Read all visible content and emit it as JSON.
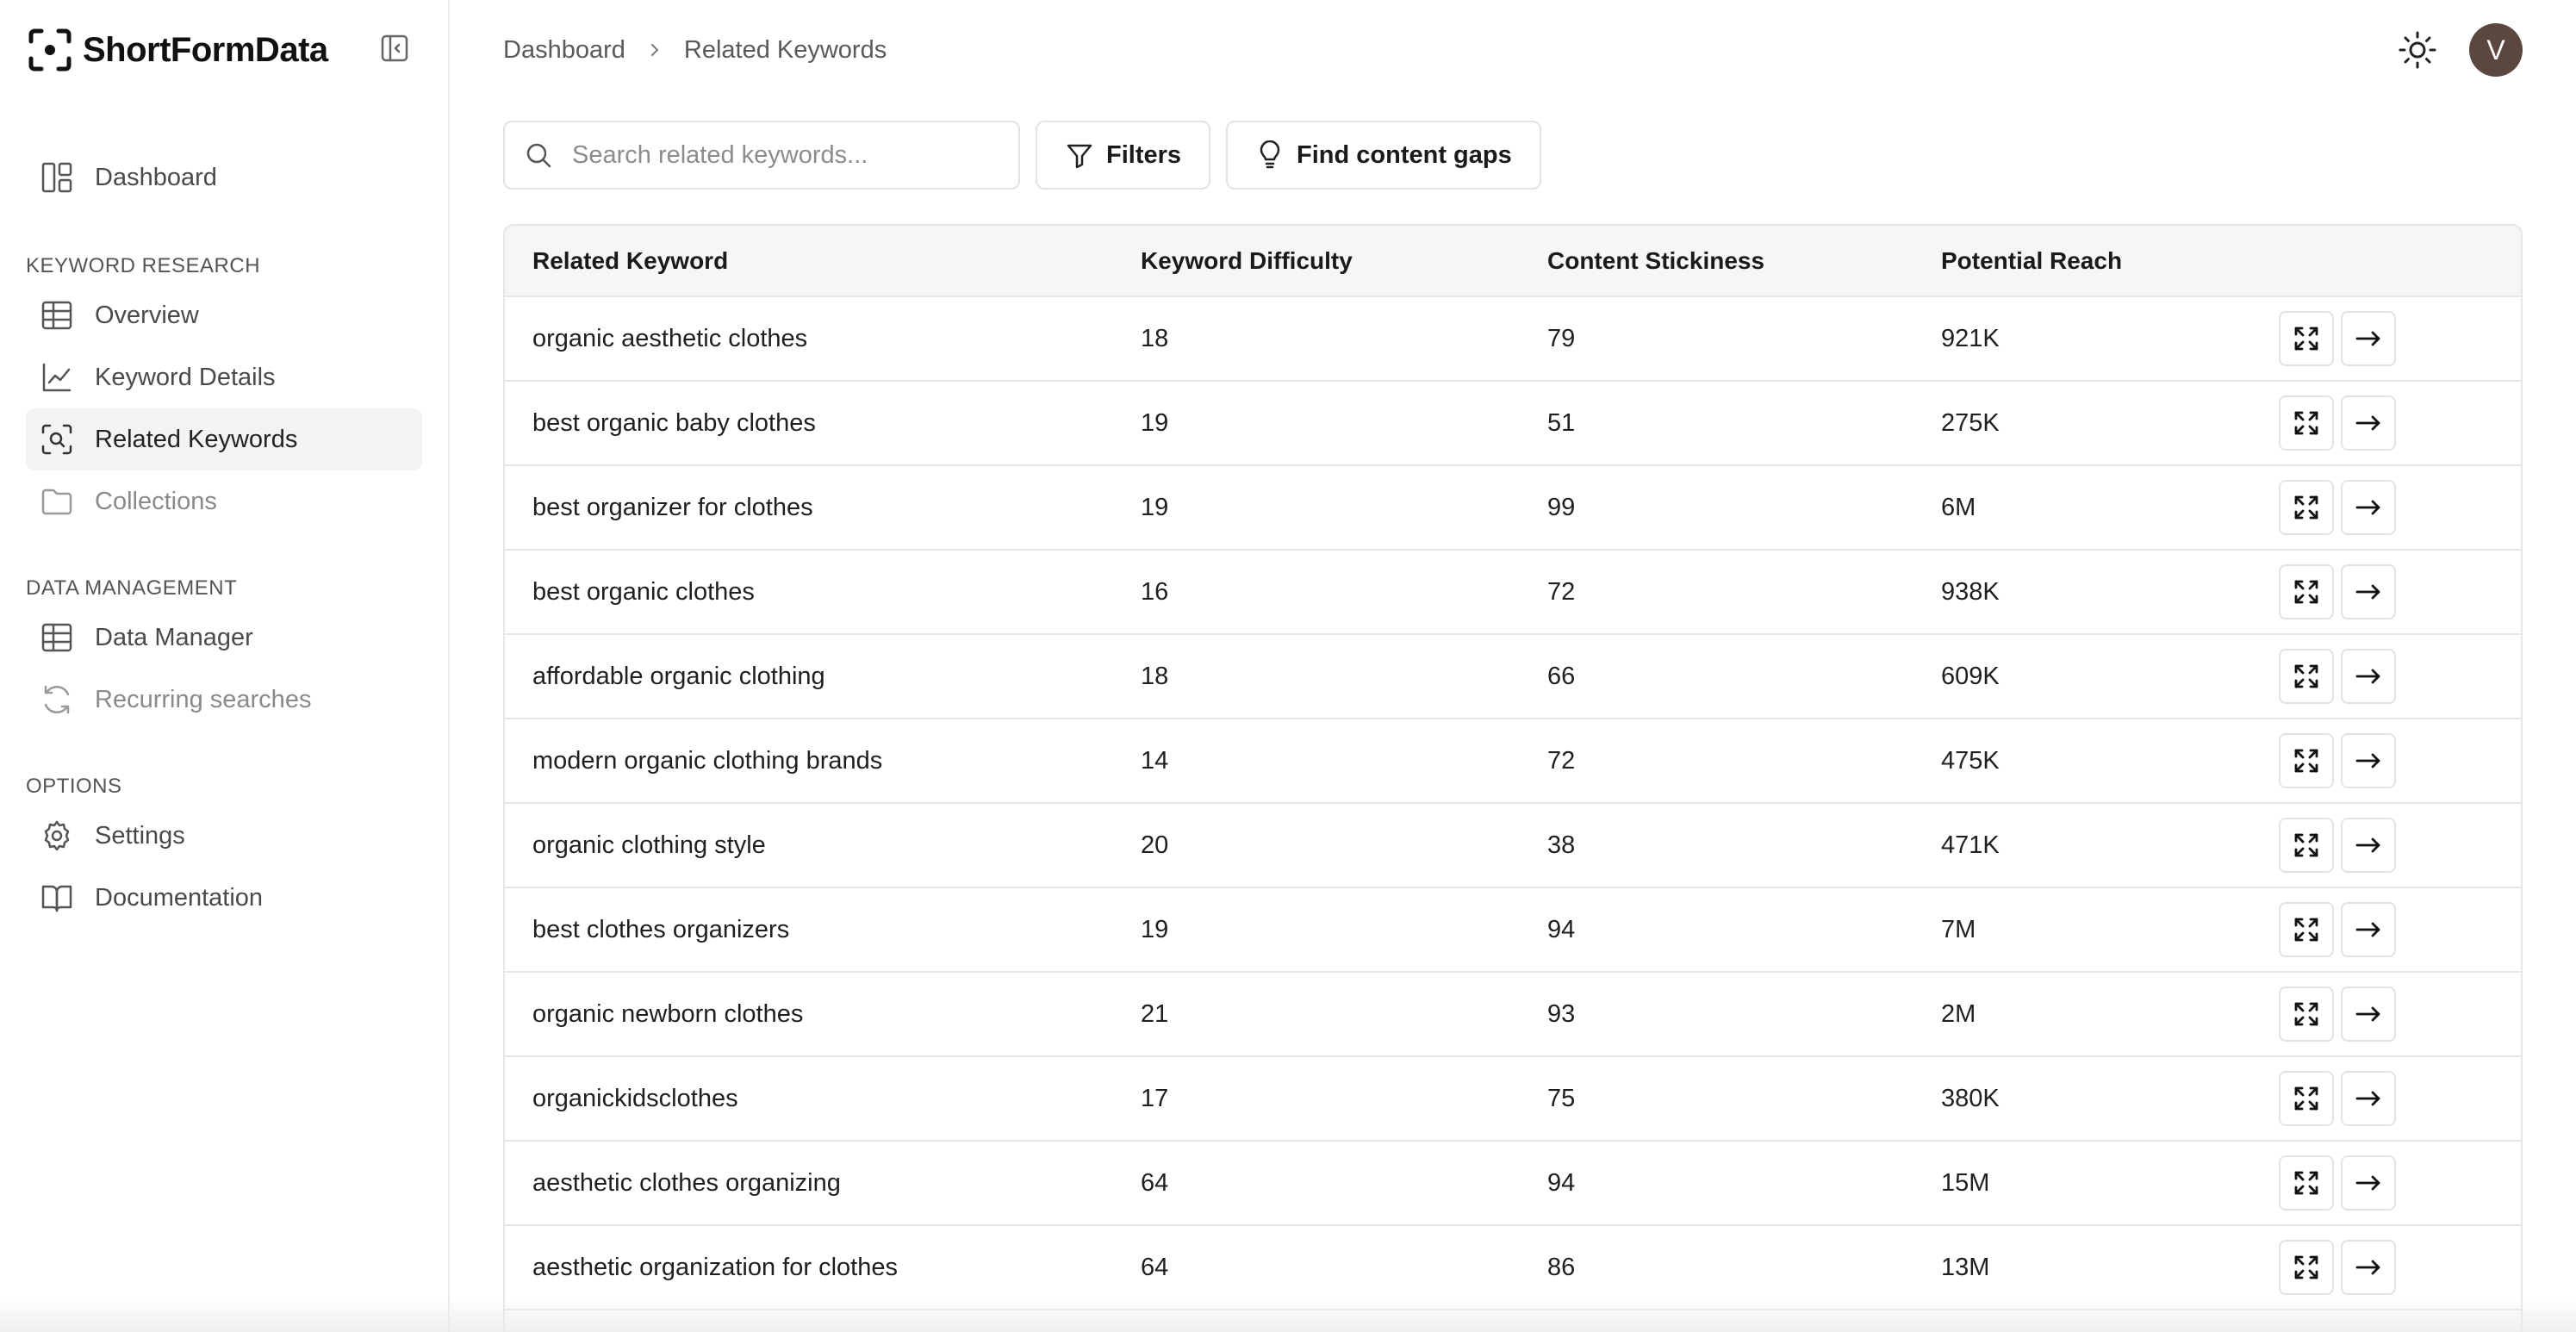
{
  "brand": {
    "name": "ShortFormData"
  },
  "sidebar": {
    "top_item": {
      "label": "Dashboard",
      "icon": "dashboard-icon"
    },
    "sections": [
      {
        "title": "KEYWORD RESEARCH",
        "items": [
          {
            "label": "Overview",
            "icon": "table-icon"
          },
          {
            "label": "Keyword Details",
            "icon": "line-chart-icon"
          },
          {
            "label": "Related Keywords",
            "icon": "scan-search-icon",
            "active": true
          },
          {
            "label": "Collections",
            "icon": "folder-icon",
            "muted": true
          }
        ]
      },
      {
        "title": "DATA MANAGEMENT",
        "items": [
          {
            "label": "Data Manager",
            "icon": "table-icon"
          },
          {
            "label": "Recurring searches",
            "icon": "refresh-icon",
            "muted": true
          }
        ]
      },
      {
        "title": "OPTIONS",
        "items": [
          {
            "label": "Settings",
            "icon": "gear-icon"
          },
          {
            "label": "Documentation",
            "icon": "book-icon"
          }
        ]
      }
    ]
  },
  "breadcrumb": {
    "items": [
      "Dashboard",
      "Related Keywords"
    ]
  },
  "user": {
    "initial": "V"
  },
  "toolbar": {
    "search_placeholder": "Search related keywords...",
    "filters_label": "Filters",
    "gaps_label": "Find content gaps"
  },
  "table": {
    "headers": [
      "Related Keyword",
      "Keyword Difficulty",
      "Content Stickiness",
      "Potential Reach"
    ],
    "rows": [
      [
        "organic aesthetic clothes",
        "18",
        "79",
        "921K"
      ],
      [
        "best organic baby clothes",
        "19",
        "51",
        "275K"
      ],
      [
        "best organizer for clothes",
        "19",
        "99",
        "6M"
      ],
      [
        "best organic clothes",
        "16",
        "72",
        "938K"
      ],
      [
        "affordable organic clothing",
        "18",
        "66",
        "609K"
      ],
      [
        "modern organic clothing brands",
        "14",
        "72",
        "475K"
      ],
      [
        "organic clothing style",
        "20",
        "38",
        "471K"
      ],
      [
        "best clothes organizers",
        "19",
        "94",
        "7M"
      ],
      [
        "organic newborn clothes",
        "21",
        "93",
        "2M"
      ],
      [
        "organickidsclothes",
        "17",
        "75",
        "380K"
      ],
      [
        "aesthetic clothes organizing",
        "64",
        "94",
        "15M"
      ],
      [
        "aesthetic organization for clothes",
        "64",
        "86",
        "13M"
      ]
    ]
  },
  "colors": {
    "avatar": "#5b4640",
    "active_nav": "#f3f3f3",
    "border": "#e6e6e6"
  }
}
